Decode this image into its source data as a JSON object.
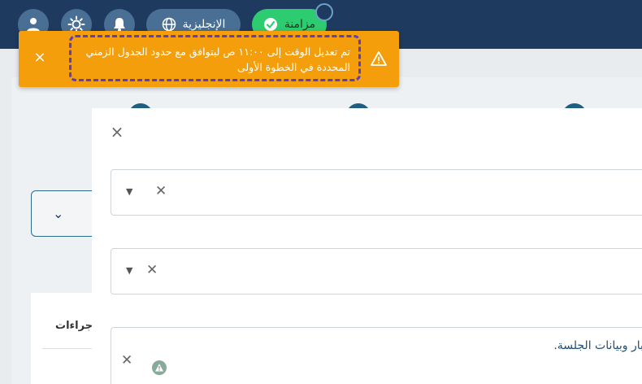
{
  "header": {
    "language_label": "الإنجليزية",
    "sync_label": "مزامنة"
  },
  "toast": {
    "message": "تم تعديل الوقت إلى ١١:٠٠ ص ليتوافق مع حدود الجدول الزمني المحددة في الخطوة الأولى",
    "close_symbol": "×"
  },
  "background": {
    "actions_header": "إجراءات"
  },
  "modal": {
    "close_symbol": "×",
    "notes_text": "اختبار وبيانات الجلسة."
  },
  "colors": {
    "topbar": "#1e3a5f",
    "toast": "#f59e0b",
    "sync": "#2ecc71",
    "focus_outline": "#5b3fbf"
  }
}
